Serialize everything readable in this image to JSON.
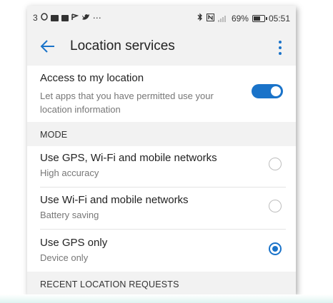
{
  "status_bar": {
    "left_text": "3",
    "battery_percent": "69%",
    "time": "05:51"
  },
  "toolbar": {
    "title": "Location services"
  },
  "access": {
    "title": "Access to my location",
    "description_line1": "Let apps that you have permitted use your",
    "description_line2": "location information",
    "enabled": true
  },
  "mode_section": {
    "label": "MODE"
  },
  "modes": [
    {
      "title": "Use GPS, Wi-Fi and mobile networks",
      "subtitle": "High accuracy",
      "selected": false
    },
    {
      "title": "Use Wi-Fi and mobile networks",
      "subtitle": "Battery saving",
      "selected": false
    },
    {
      "title": "Use GPS only",
      "subtitle": "Device only",
      "selected": true
    }
  ],
  "recent_section": {
    "label": "RECENT LOCATION REQUESTS"
  },
  "colors": {
    "accent": "#1a73c9",
    "header_bg": "#f2f2f2"
  }
}
